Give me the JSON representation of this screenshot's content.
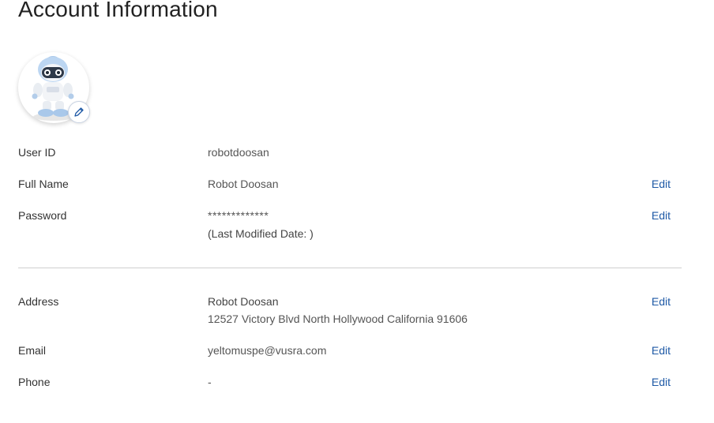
{
  "page": {
    "title": "Account Information"
  },
  "profile": {
    "avatar_icon": "robot-avatar",
    "edit_icon": "pencil-icon"
  },
  "fields": {
    "user_id": {
      "label": "User ID",
      "value": "robotdoosan"
    },
    "full_name": {
      "label": "Full Name",
      "value": "Robot Doosan",
      "action": "Edit"
    },
    "password": {
      "label": "Password",
      "value": "*************",
      "note": "(Last Modified Date: )",
      "action": "Edit"
    },
    "address": {
      "label": "Address",
      "name": "Robot Doosan",
      "line": "12527 Victory Blvd North Hollywood California 91606",
      "action": "Edit"
    },
    "email": {
      "label": "Email",
      "value": "yeltomuspe@vusra.com",
      "action": "Edit"
    },
    "phone": {
      "label": "Phone",
      "value": "-",
      "action": "Edit"
    }
  },
  "colors": {
    "link": "#1f5aa6",
    "divider": "#cfcfcf",
    "text": "#333333"
  }
}
